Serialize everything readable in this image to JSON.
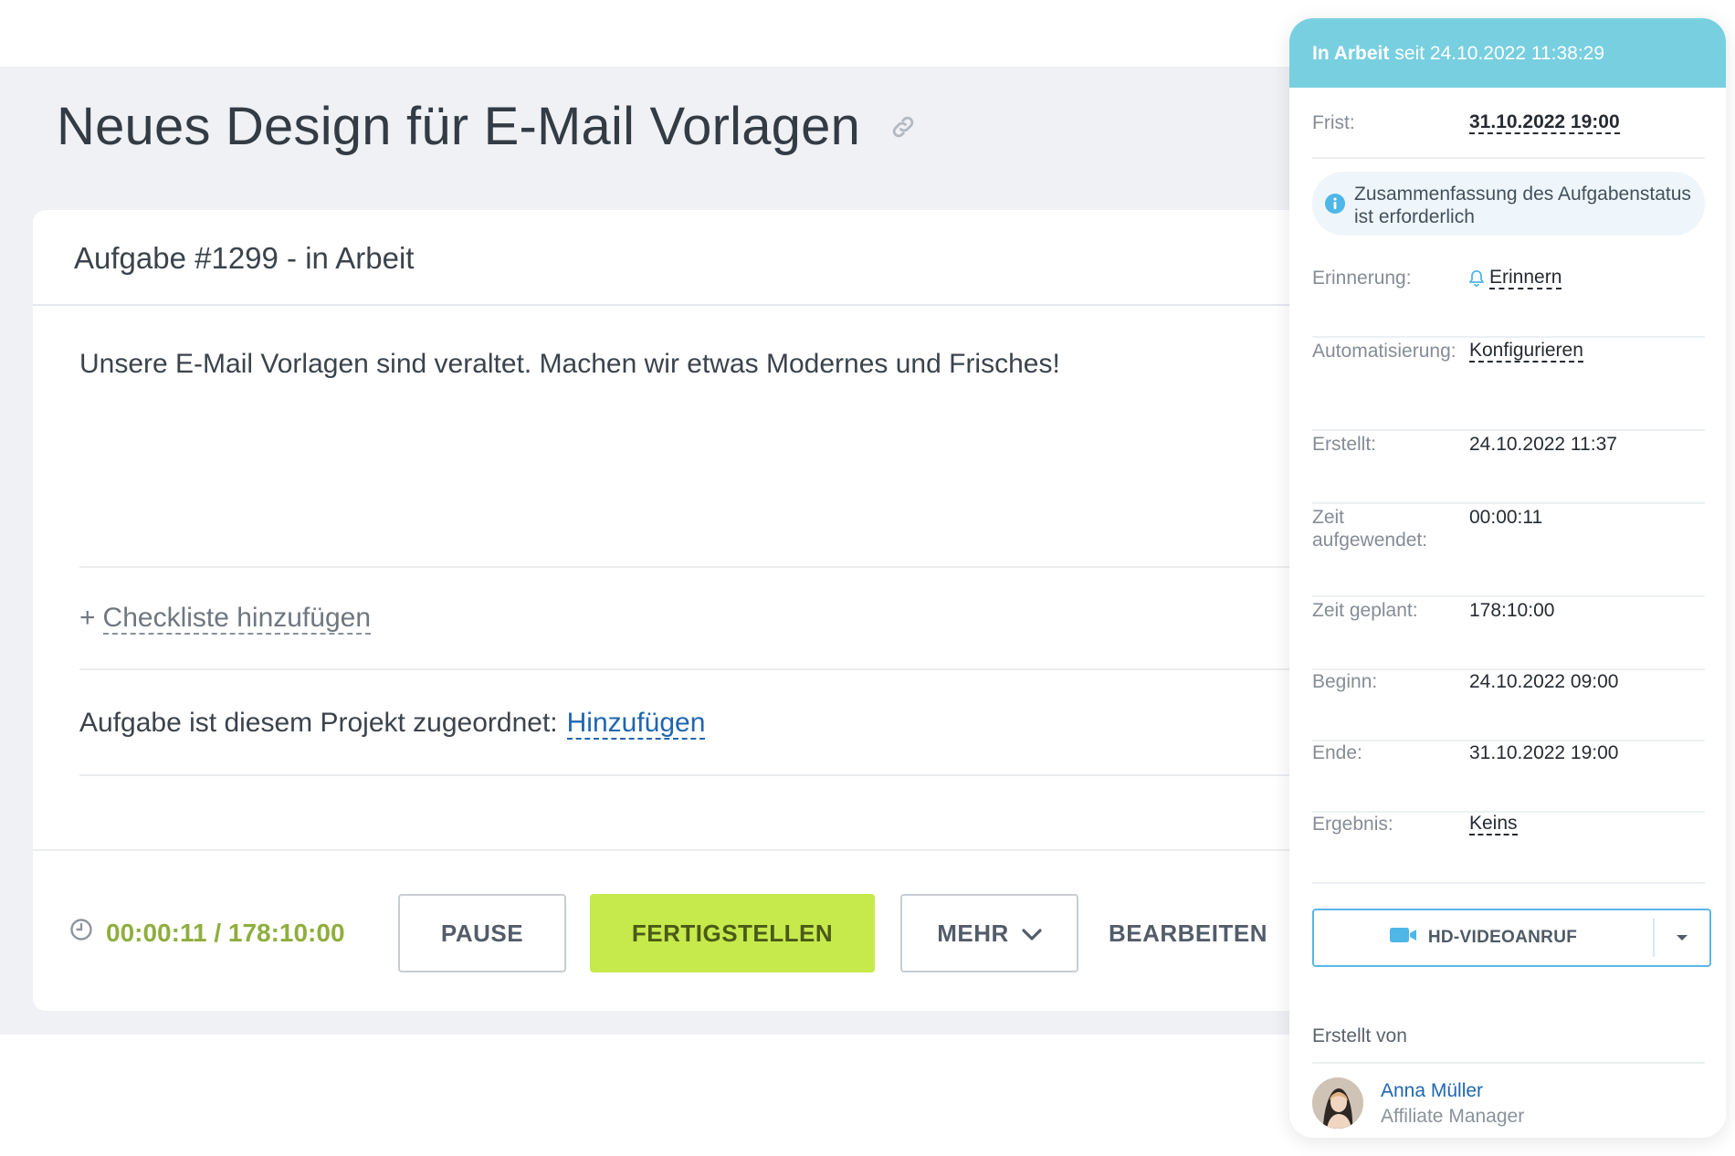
{
  "page": {
    "title": "Neues Design für E-Mail Vorlagen"
  },
  "task": {
    "header": "Aufgabe #1299 - in Arbeit",
    "description": "Unsere E-Mail Vorlagen sind veraltet. Machen wir etwas Modernes und Frisches!",
    "checklist_plus": "+",
    "checklist_label": "Checkliste hinzufügen",
    "project_label": "Aufgabe ist diesem Projekt zugeordnet:",
    "project_link": "Hinzufügen"
  },
  "actions": {
    "timer": "00:00:11 / 178:10:00",
    "pause": "PAUSE",
    "finish": "FERTIGSTELLEN",
    "more": "MEHR",
    "edit": "BEARBEITEN"
  },
  "sidebar": {
    "status_strong": "In Arbeit",
    "status_since": "seit 24.10.2022 11:38:29",
    "notice": "Zusammenfassung des Aufgabenstatus ist erforderlich",
    "fields": {
      "deadline": {
        "label": "Frist:",
        "value": "31.10.2022 19:00"
      },
      "reminder": {
        "label": "Erinnerung:",
        "value": "Erinnern"
      },
      "automation": {
        "label": "Automatisierung:",
        "value": "Konfigurieren"
      },
      "created": {
        "label": "Erstellt:",
        "value": "24.10.2022 11:37"
      },
      "time_spent": {
        "label": "Zeit aufgewendet:",
        "value": "00:00:11"
      },
      "time_planned": {
        "label": "Zeit geplant:",
        "value": "178:10:00"
      },
      "start": {
        "label": "Beginn:",
        "value": "24.10.2022 09:00"
      },
      "end": {
        "label": "Ende:",
        "value": "31.10.2022 19:00"
      },
      "result": {
        "label": "Ergebnis:",
        "value": "Keins"
      }
    },
    "video_call": "HD-VIDEOANRUF",
    "created_by_label": "Erstellt von",
    "creator": {
      "name": "Anna Müller",
      "role": "Affiliate Manager"
    }
  },
  "colors": {
    "status_header": "#78cfe0",
    "finish_button": "#c6ea4c",
    "timer": "#8fae3e",
    "link": "#2066b0",
    "video_border": "#59b6e6"
  },
  "icons": [
    "link-icon",
    "clock-icon",
    "chevron-down-icon",
    "info-icon",
    "bell-icon",
    "video-camera-icon",
    "caret-down-icon"
  ]
}
